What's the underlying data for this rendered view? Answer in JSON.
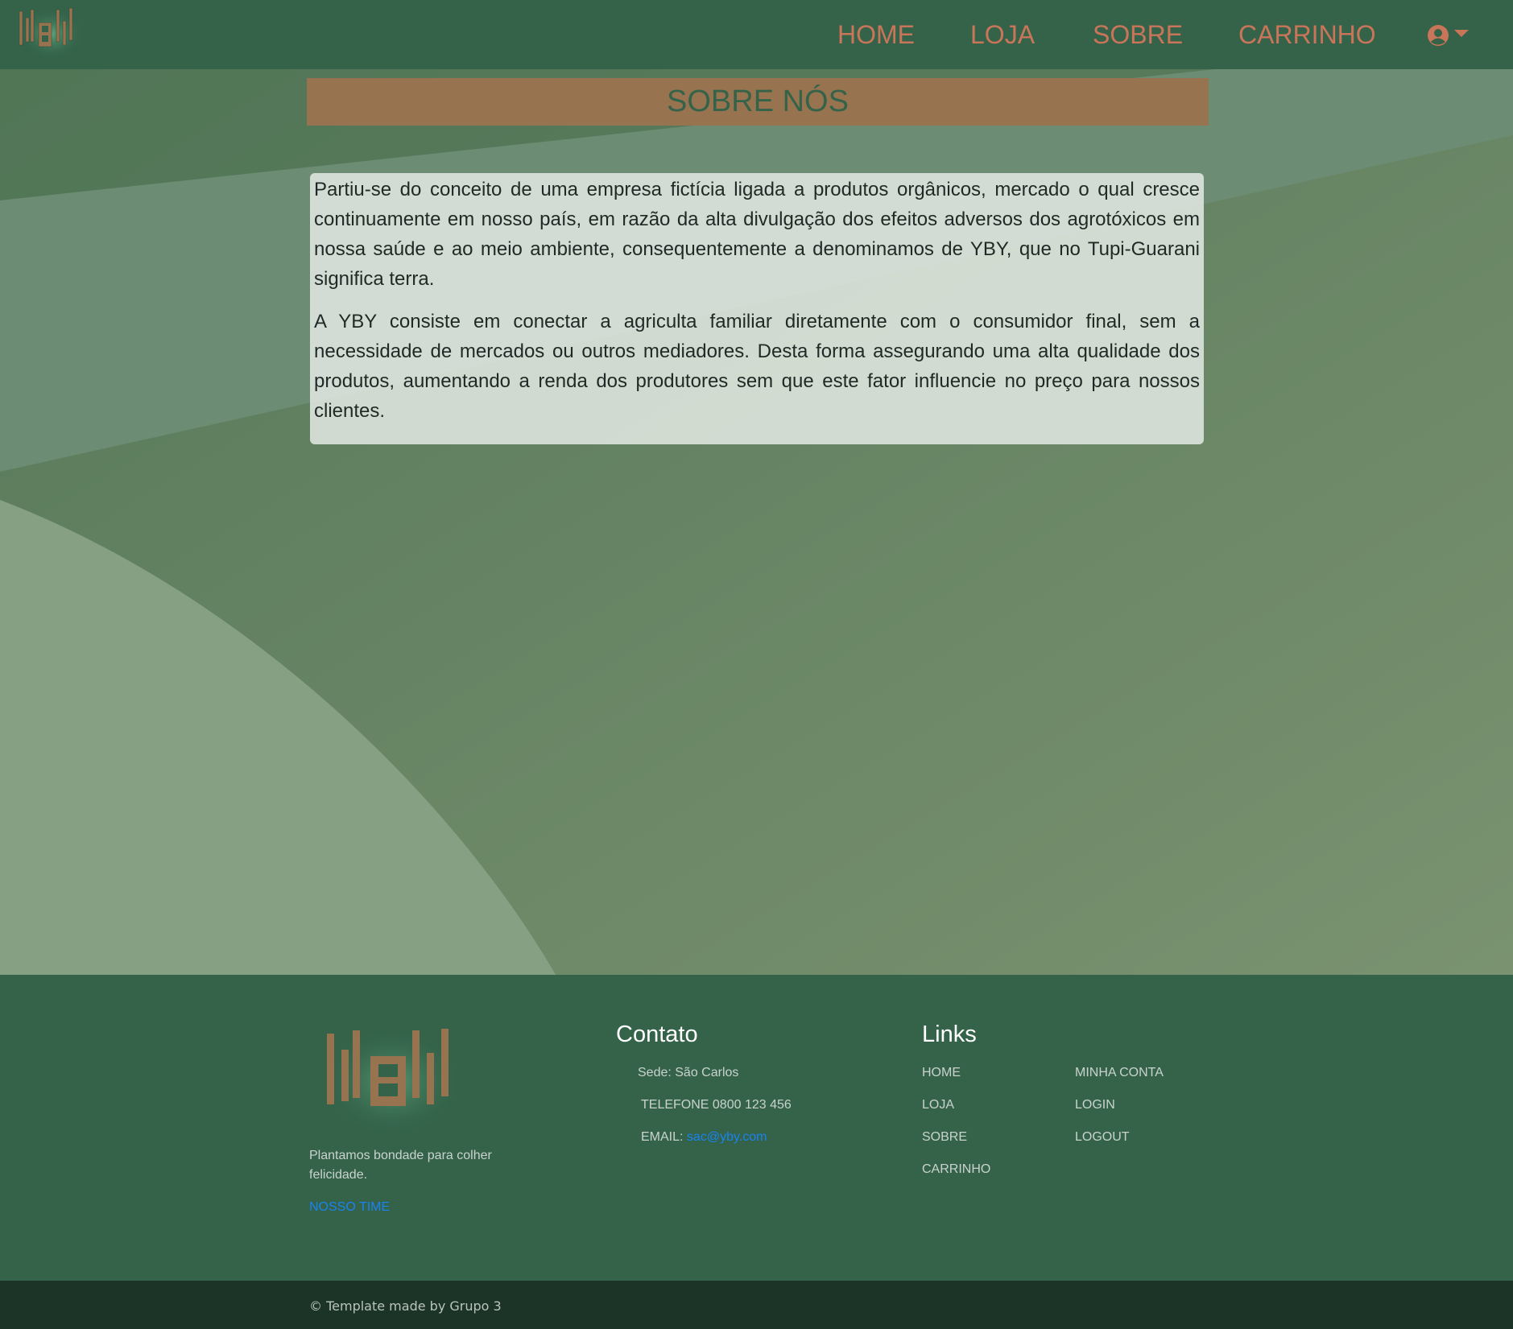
{
  "navbar": {
    "brand_logo": "yby-logo",
    "links": [
      {
        "label": "HOME"
      },
      {
        "label": "LOJA"
      },
      {
        "label": "SOBRE"
      },
      {
        "label": "CARRINHO"
      }
    ],
    "account_icon": "user-circle-icon",
    "colors": {
      "background": "#34634a",
      "link": "#c97559"
    }
  },
  "main": {
    "title": "SOBRE NÓS",
    "paragraphs": [
      "Partiu-se do conceito de uma empresa fictícia ligada a produtos orgânicos, mercado o qual cresce continuamente em nosso país, em razão da alta divulgação dos efeitos adversos dos agrotóxicos em nossa saúde e ao meio ambiente, consequentemente a denominamos de YBY, que no Tupi-Guarani significa terra.",
      "A YBY consiste em conectar a agriculta familiar diretamente com o consumidor final, sem a necessidade de mercados ou outros mediadores. Desta forma assegurando uma alta qualidade dos produtos, aumentando a renda dos produtores sem que este fator influencie no preço para nossos clientes."
    ],
    "colors": {
      "banner": "#98734f",
      "title": "#34634a"
    }
  },
  "footer": {
    "tagline": "Plantamos bondade para colher felicidade.",
    "team_link": "NOSSO TIME",
    "contact": {
      "heading": "Contato",
      "address": "Sede: São Carlos",
      "phone": "TELEFONE 0800 123 456",
      "email_label": "EMAIL:",
      "email": "sac@yby.com"
    },
    "links": {
      "heading": "Links",
      "col1": [
        "HOME",
        "LOJA",
        "SOBRE",
        "CARRINHO"
      ],
      "col2": [
        "MINHA CONTA",
        "LOGIN",
        "LOGOUT"
      ]
    },
    "copyright": "© Template made by Grupo 3",
    "colors": {
      "link_accent": "#1a82f0",
      "bottom_bar": "#1b3427"
    }
  }
}
